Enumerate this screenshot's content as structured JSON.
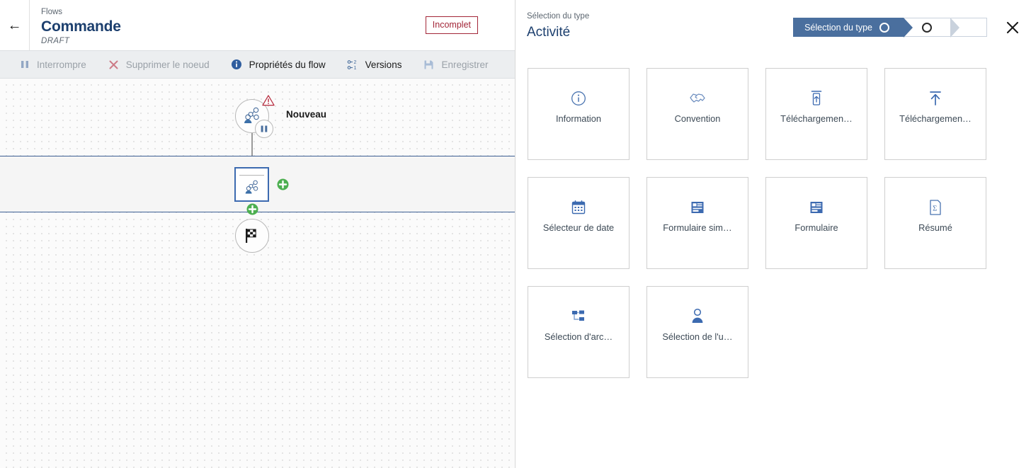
{
  "left": {
    "back_icon": "arrow-left-icon",
    "breadcrumb": "Flows",
    "title": "Commande",
    "state": "DRAFT",
    "badge": "Incomplet",
    "toolbar": [
      {
        "label": "Interrompre",
        "icon": "pause-icon",
        "disabled": true
      },
      {
        "label": "Supprimer le noeud",
        "icon": "close-x-icon",
        "disabled": true
      },
      {
        "label": "Propriétés du flow",
        "icon": "info-icon",
        "disabled": false
      },
      {
        "label": "Versions",
        "icon": "versions-icon",
        "disabled": false
      },
      {
        "label": "Enregistrer",
        "icon": "save-icon",
        "disabled": true
      }
    ],
    "canvas": {
      "start_node_label": "Nouveau",
      "start_node_icon": "workflow-user-icon",
      "warning_icon": "warning-triangle-icon",
      "pause_icon": "pause-icon",
      "activity_node_icon": "workflow-user-icon",
      "end_node_icon": "checkered-flag-icon",
      "add_node_icon": "plus-circle-icon"
    }
  },
  "right": {
    "breadcrumb": "Sélection du type",
    "title": "Activité",
    "close_icon": "close-icon",
    "stepper": [
      {
        "label": "Sélection du type",
        "state": "active"
      },
      {
        "label": "",
        "state": "pending"
      },
      {
        "label": "",
        "state": "pending"
      }
    ],
    "cards": [
      {
        "label": "Information",
        "icon": "info-circle-icon"
      },
      {
        "label": "Convention",
        "icon": "handshake-icon"
      },
      {
        "label": "Téléchargemen…",
        "icon": "document-upload-icon"
      },
      {
        "label": "Téléchargemen…",
        "icon": "arrow-up-bar-icon"
      },
      {
        "label": "Sélecteur de date",
        "icon": "calendar-icon"
      },
      {
        "label": "Formulaire sim…",
        "icon": "form-simple-icon"
      },
      {
        "label": "Formulaire",
        "icon": "form-icon"
      },
      {
        "label": "Résumé",
        "icon": "sigma-document-icon"
      },
      {
        "label": "Sélection d'arc…",
        "icon": "tree-hierarchy-icon"
      },
      {
        "label": "Sélection de l'u…",
        "icon": "user-icon"
      }
    ]
  },
  "colors": {
    "brand_navy": "#1c3f6e",
    "step_blue": "#4a6f9e",
    "badge_red": "#a32638",
    "plus_green": "#4caf50",
    "lane_blue": "#3c5f93"
  }
}
